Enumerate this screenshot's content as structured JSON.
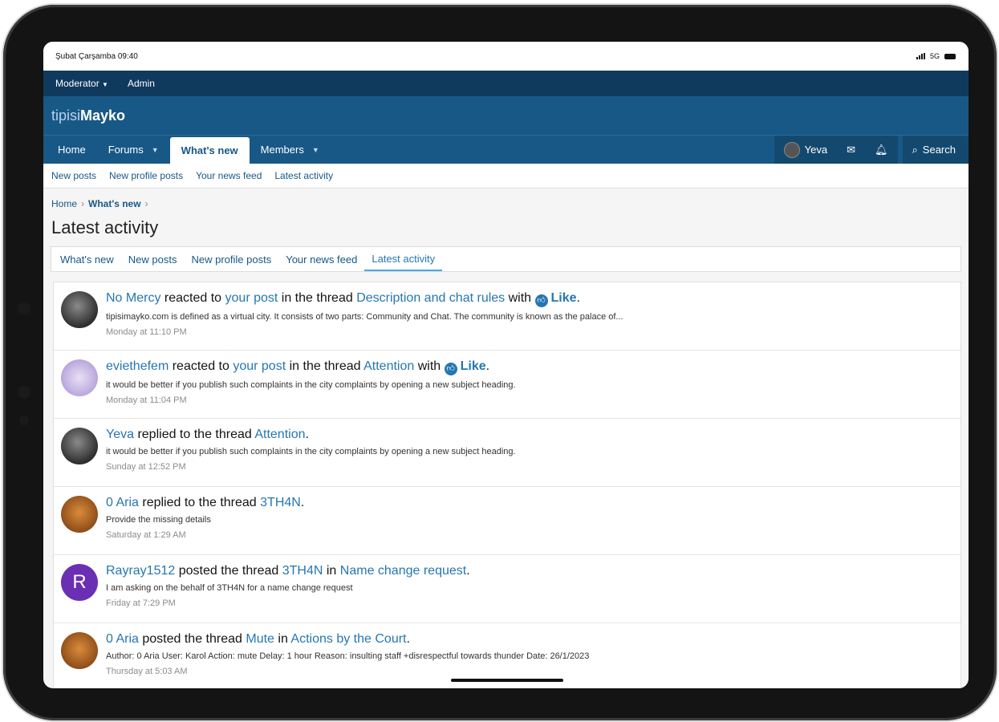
{
  "status_bar": {
    "datetime": "Şubat Çarşamba 09:40",
    "network": "5G"
  },
  "staff_bar": {
    "moderator": "Moderator",
    "admin": "Admin"
  },
  "logo": {
    "part1": "tipisi",
    "part2": "Mayko"
  },
  "nav": {
    "tabs": [
      {
        "label": "Home"
      },
      {
        "label": "Forums"
      },
      {
        "label": "What's new"
      },
      {
        "label": "Members"
      }
    ],
    "user": "Yeva",
    "search": "Search"
  },
  "subnav": [
    "New posts",
    "New profile posts",
    "Your news feed",
    "Latest activity"
  ],
  "breadcrumb": {
    "home": "Home",
    "current": "What's new"
  },
  "page_title": "Latest activity",
  "filter_tabs": [
    "What's new",
    "New posts",
    "New profile posts",
    "Your news feed",
    "Latest activity"
  ],
  "activities": [
    {
      "user": "No Mercy",
      "t1": "reacted to",
      "l1": "your post",
      "t2": "in the thread",
      "l2": "Description and chat rules",
      "t3": "with",
      "reaction": "Like",
      "end": ".",
      "snippet": "tipisimayko.com is defined as a virtual city. It consists of two parts: Community and Chat. The community is known as the palace of...",
      "time": "Monday at 11:10 PM"
    },
    {
      "user": "eviethefem",
      "t1": "reacted to",
      "l1": "your post",
      "t2": "in the thread",
      "l2": "Attention",
      "t3": "with",
      "reaction": "Like",
      "end": ".",
      "snippet": "it would be better if you publish such complaints in the city complaints by opening a new subject heading.",
      "time": "Monday at 11:04 PM"
    },
    {
      "user": "Yeva",
      "t1": "replied to the thread",
      "l2": "Attention",
      "end": ".",
      "snippet": "it would be better if you publish such complaints in the city complaints by opening a new subject heading.",
      "time": "Sunday at 12:52 PM"
    },
    {
      "user": "0 Aria",
      "t1": "replied to the thread",
      "l2": "3TH4N",
      "end": ".",
      "snippet": "Provide the missing details",
      "time": "Saturday at 1:29 AM"
    },
    {
      "user": "Rayray1512",
      "avatar_letter": "R",
      "t1": "posted the thread",
      "l2": "3TH4N",
      "t2": "in",
      "l3": "Name change request",
      "end": ".",
      "snippet": "I am asking on the behalf of 3TH4N for a name change request",
      "time": "Friday at 7:29 PM"
    },
    {
      "user": "0 Aria",
      "t1": "posted the thread",
      "l2": "Mute",
      "t2": "in",
      "l3": "Actions by the Court",
      "end": ".",
      "snippet": "Author: 0 Aria User: Karol Action: mute Delay: 1 hour Reason: insulting staff +disrespectful towards thunder Date: 26/1/2023",
      "time": "Thursday at 5:03 AM"
    }
  ],
  "colors": {
    "header": "#185886",
    "staffbar": "#0f3a5e",
    "link": "#2577b1"
  }
}
